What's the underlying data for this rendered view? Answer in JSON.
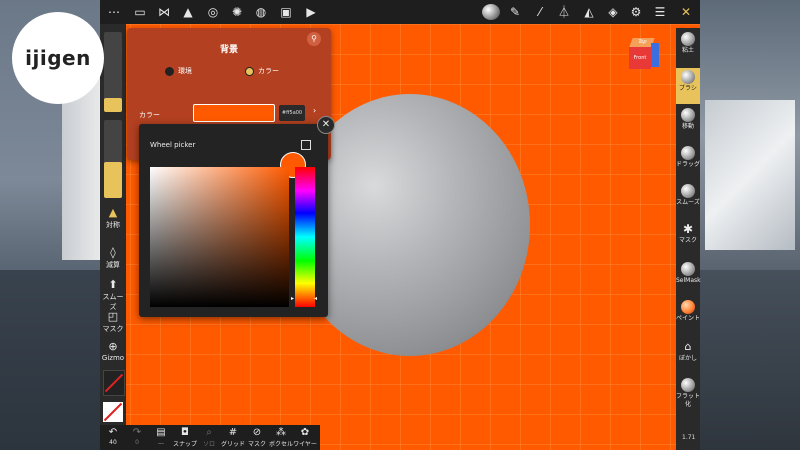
{
  "watermark": {
    "text": "ijigen"
  },
  "topbar": {
    "icons": [
      "menu-dots-icon",
      "folder-icon",
      "scene-graph-icon",
      "mesh-grid-icon",
      "globe-icon",
      "sun-icon",
      "material-icon",
      "image-icon",
      "camera-icon",
      "matcap-sphere-icon",
      "pencil-icon",
      "eyedropper-icon",
      "symmetry-icon",
      "triangle-icon",
      "layers-icon",
      "gear-icon",
      "sliders-icon",
      "tools-icon"
    ]
  },
  "background_panel": {
    "title": "背景",
    "mode_options": [
      {
        "label": "環境",
        "selected": false
      },
      {
        "label": "カラー",
        "selected": true
      }
    ],
    "color_label": "カラー",
    "color_hex": "#ff5a00",
    "color_swatch": "#ff5a00"
  },
  "color_picker": {
    "title": "Wheel picker",
    "current_color": "#ff5a00"
  },
  "left_toolbar": {
    "items": [
      {
        "label": "対称",
        "icon": "triangle-icon"
      },
      {
        "label": "減算",
        "icon": "drop-icon"
      },
      {
        "label": "スムーズ",
        "icon": "smooth-icon"
      },
      {
        "label": "マスク",
        "icon": "mask-icon"
      },
      {
        "label": "Gizmo",
        "icon": "gizmo-icon"
      }
    ]
  },
  "right_toolbar": {
    "items": [
      {
        "label": "粘土",
        "active": false
      },
      {
        "label": "ブラシ",
        "active": true
      },
      {
        "label": "移動",
        "active": false
      },
      {
        "label": "ドラッグ",
        "active": false
      },
      {
        "label": "スムーズ",
        "active": false
      },
      {
        "label": "マスク",
        "active": false
      },
      {
        "label": "SelMask",
        "active": false
      },
      {
        "label": "ペイント",
        "active": false
      },
      {
        "label": "ぼかし",
        "active": false
      },
      {
        "label": "フラット化",
        "active": false
      }
    ]
  },
  "bottom_toolbar": {
    "items": [
      {
        "label": "40",
        "icon": "undo-icon"
      },
      {
        "label": "0",
        "icon": "redo-icon"
      },
      {
        "label": "...",
        "icon": "save-icon"
      },
      {
        "label": "スナップ",
        "icon": "snapshot-icon"
      },
      {
        "label": "ソロ",
        "icon": "search-icon"
      },
      {
        "label": "グリッド",
        "icon": "grid-icon"
      },
      {
        "label": "マスク",
        "icon": "eye-off-icon"
      },
      {
        "label": "ボクセル",
        "icon": "voxel-icon"
      },
      {
        "label": "ワイヤー",
        "icon": "wire-icon"
      }
    ]
  },
  "view_cube": {
    "front_label": "Front",
    "top_label": "Top"
  },
  "version": "1.71"
}
